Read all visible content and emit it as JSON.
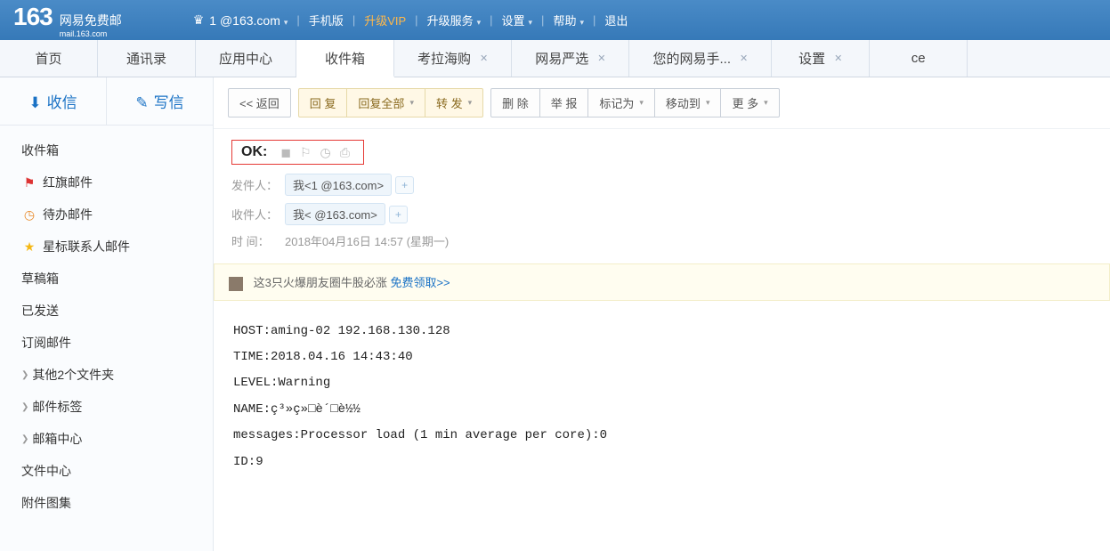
{
  "header": {
    "logo_num": "163",
    "logo_cn": "网易免费邮",
    "logo_en": "mail.163.com",
    "user_email": "1                @163.com",
    "links": {
      "mobile": "手机版",
      "vip": "升级VIP",
      "upgrade_service": "升级服务",
      "settings": "设置",
      "help": "帮助",
      "logout": "退出"
    }
  },
  "tabs": [
    {
      "label": "首页",
      "closable": false
    },
    {
      "label": "通讯录",
      "closable": false
    },
    {
      "label": "应用中心",
      "closable": false
    },
    {
      "label": "收件箱",
      "closable": false,
      "active": true
    },
    {
      "label": "考拉海购",
      "closable": true
    },
    {
      "label": "网易严选",
      "closable": true
    },
    {
      "label": "您的网易手...",
      "closable": true
    },
    {
      "label": "设置",
      "closable": true
    },
    {
      "label": "ce",
      "closable": false
    }
  ],
  "sidebar": {
    "receive": "收信",
    "compose": "写信",
    "folders": {
      "inbox": "收件箱",
      "flagged": "红旗邮件",
      "todo": "待办邮件",
      "starred": "星标联系人邮件",
      "drafts": "草稿箱",
      "sent": "已发送",
      "subscribe": "订阅邮件",
      "other_folders": "其他2个文件夹",
      "tags": "邮件标签",
      "center": "邮箱中心",
      "file_center": "文件中心",
      "attachments": "附件图集"
    }
  },
  "toolbar": {
    "back": "<< 返回",
    "reply": "回 复",
    "reply_all": "回复全部",
    "forward": "转 发",
    "delete": "删 除",
    "report": "举 报",
    "mark_as": "标记为",
    "move_to": "移动到",
    "more": "更 多"
  },
  "mail": {
    "subject": "OK:",
    "from_label": "发件人：",
    "from_value": "我<1               @163.com>",
    "to_label": "收件人：",
    "to_value": "我<                 @163.com>",
    "time_label": "时   间：",
    "time_value": "2018年04月16日 14:57 (星期一)",
    "promo_text": "这3只火爆朋友圈牛股必涨 ",
    "promo_link": "免费领取>>",
    "body_lines": [
      "HOST:aming-02 192.168.130.128",
      "TIME:2018.04.16  14:43:40",
      "LEVEL:Warning",
      "NAME:ç³»ç»□è´□è½½",
      "messages:Processor load (1 min average per core):0",
      "ID:9"
    ]
  }
}
